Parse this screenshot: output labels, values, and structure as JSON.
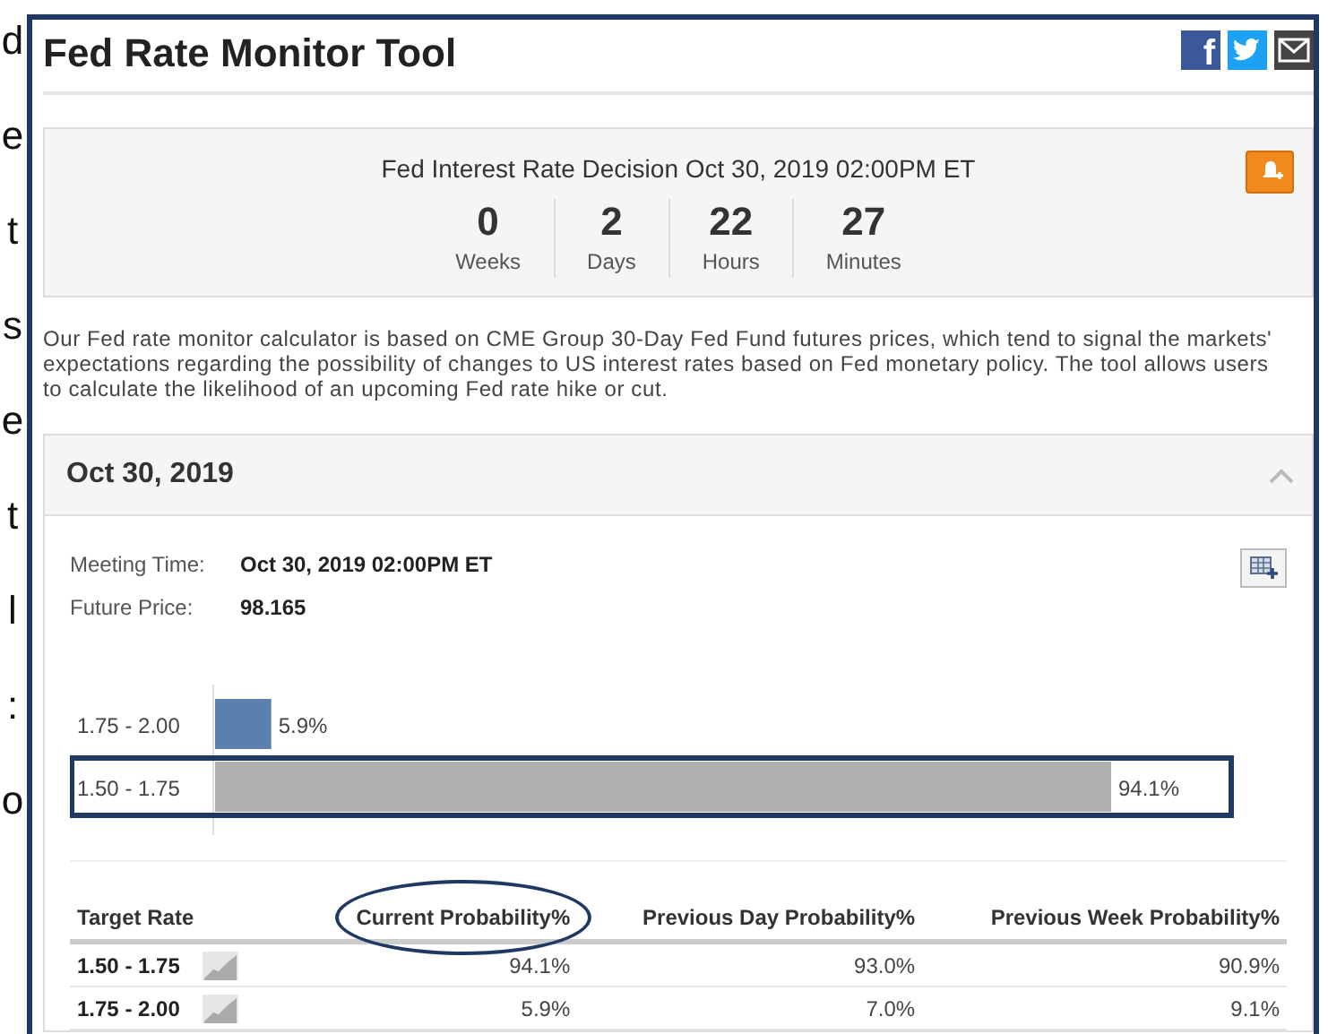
{
  "margin_letters": [
    "d",
    "e",
    "t",
    "s",
    "e",
    "t",
    "l",
    ":",
    "o"
  ],
  "page": {
    "title": "Fed Rate Monitor Tool",
    "share": [
      {
        "kind": "facebook",
        "glyph": "f"
      },
      {
        "kind": "twitter"
      },
      {
        "kind": "email"
      }
    ]
  },
  "countdown": {
    "title": "Fed Interest Rate Decision Oct 30, 2019 02:00PM ET",
    "units": [
      {
        "value": "0",
        "label": "Weeks"
      },
      {
        "value": "2",
        "label": "Days"
      },
      {
        "value": "22",
        "label": "Hours"
      },
      {
        "value": "27",
        "label": "Minutes"
      }
    ]
  },
  "description": "Our Fed rate monitor calculator is based on CME Group 30-Day Fed Fund futures prices, which tend to signal the markets' expectations regarding the possibility of changes to US interest rates based on Fed monetary policy. The tool allows users to calculate the likelihood of an upcoming Fed rate hike or cut.",
  "meeting_panel": {
    "title": "Oct 30, 2019",
    "expanded": true,
    "fields": [
      {
        "label": "Meeting Time:",
        "value": "Oct 30, 2019 02:00PM ET"
      },
      {
        "label": "Future Price:",
        "value": "98.165"
      }
    ],
    "chart_highlight": [
      false,
      true
    ],
    "chart_data": {
      "type": "bar",
      "orientation": "horizontal",
      "categories": [
        "1.75 - 2.00",
        "1.50 - 1.75"
      ],
      "series": [
        {
          "color": "#5b80ad",
          "values": [
            5.9,
            null
          ],
          "value_labels": [
            "5.9%",
            null
          ]
        },
        {
          "color": "#b0b0b0",
          "values": [
            null,
            94.1
          ],
          "value_labels": [
            null,
            "94.1%"
          ]
        }
      ]
    },
    "table": {
      "columns": [
        {
          "label": "Target Rate",
          "circled": false
        },
        {
          "label": "Current Probability%",
          "circled": true
        },
        {
          "label": "Previous Day Probability%",
          "circled": false
        },
        {
          "label": "Previous Week Probability%",
          "circled": false
        }
      ],
      "rows": [
        {
          "cells": [
            "1.50 - 1.75",
            "94.1%",
            "93.0%",
            "90.9%"
          ]
        },
        {
          "cells": [
            "1.75 - 2.00",
            "5.9%",
            "7.0%",
            "9.1%"
          ]
        }
      ]
    }
  }
}
